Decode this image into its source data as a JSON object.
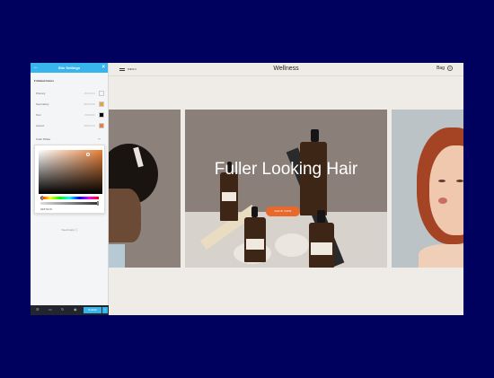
{
  "panel": {
    "title": "Site Settings",
    "section": "Global Colors",
    "colors": [
      {
        "name": "Primary",
        "hex": "#F4F4F4",
        "swatch": "#f4f4f4"
      },
      {
        "name": "Secondary",
        "hex": "#E5A53E",
        "swatch": "#e5a53e"
      },
      {
        "name": "Text",
        "hex": "#000000",
        "swatch": "#000000"
      },
      {
        "name": "Accent",
        "hex": "#E8813A",
        "swatch": "#e8813a"
      }
    ],
    "picker_label": "Color Picker",
    "hex_value": "#E87D2D",
    "back_help": "Need Help",
    "publish": "Publish",
    "footer_icons": [
      "layers-icon",
      "responsive-icon",
      "history-icon",
      "preview-icon"
    ]
  },
  "site": {
    "menu": "MENU",
    "brand": "Wellness",
    "bag": "Bag",
    "bag_count": "0",
    "hero_title": "Fuller Looking Hair",
    "shop_button": "SHOP NOW"
  }
}
